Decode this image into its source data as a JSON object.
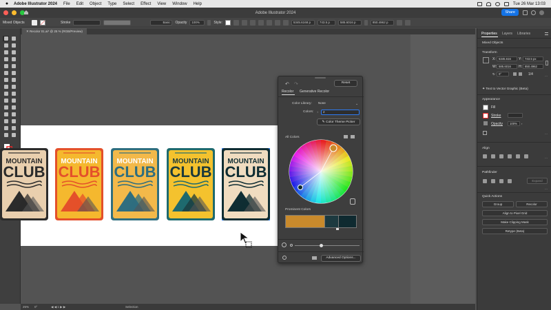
{
  "menubar": {
    "app_name": "Adobe Illustrator 2024",
    "items": [
      "File",
      "Edit",
      "Object",
      "Type",
      "Select",
      "Effect",
      "View",
      "Window",
      "Help"
    ],
    "clock": "Tue 26 Mar  13:03"
  },
  "window": {
    "title": "Adobe Illustrator 2024",
    "share_label": "Share"
  },
  "controlbar": {
    "selection_type": "Mixed Objects",
    "stroke_label": "Stroke",
    "brush_label": "Basic",
    "opacity_label": "Opacity",
    "opacity_value": "100%",
    "style_label": "Style:",
    "x_value": "5345.6168 p",
    "y_value": "743.5 p",
    "w_value": "585.6016 p",
    "h_value": "850.4962 p"
  },
  "document": {
    "tab_label": "Recolor 01.ai* @ 25 % (RGB/Preview)"
  },
  "statusbar": {
    "zoom": "25%",
    "tool": "Selection"
  },
  "badges": [
    {
      "top": "MOUNTAIN",
      "bottom": "CLUB",
      "bg": "#e9cfae",
      "frame": "#2b2b2b",
      "text1": "#2b2b2b",
      "text2": "#2b2b2b"
    },
    {
      "top": "MOUNTAIN",
      "bottom": "CLUB",
      "bg": "#f5b82e",
      "frame": "#e4502a",
      "text1": "#ffffff",
      "text2": "#e4502a"
    },
    {
      "top": "MOUNTAIN",
      "bottom": "CLUB",
      "bg": "#f3b94a",
      "frame": "#2f6e7f",
      "text1": "#ffffff",
      "text2": "#2f6e7f"
    },
    {
      "top": "MOUNTAIN",
      "bottom": "CLUB",
      "bg": "#f4c22e",
      "frame": "#1e6a6e",
      "text1": "#1b3a3c",
      "text2": "#1b3a3c"
    },
    {
      "top": "MOUNTAIN",
      "bottom": "CLUB",
      "bg": "#f0dcc0",
      "frame": "#0f2d33",
      "text1": "#0f2d33",
      "text2": "#0f2d33"
    }
  ],
  "recolor": {
    "reset_label": "Reset",
    "tabs": [
      "Recolor",
      "Generative Recolor"
    ],
    "color_library_label": "Color Library:",
    "color_library_value": "None",
    "colors_label": "Colors:",
    "colors_value": "2",
    "theme_picker_label": "Color Theme Picker",
    "all_colors_label": "All Colors",
    "prominent_colors_label": "Prominent Colors",
    "prominent_colors": [
      "#c98a2c",
      "#1d3a40",
      "#0f2a30"
    ],
    "advanced_label": "Advanced Options..."
  },
  "properties": {
    "tabs": [
      "Properties",
      "Layers",
      "Libraries"
    ],
    "selection_type": "Mixed Objects",
    "transform_title": "Transform",
    "x_label": "X:",
    "x_value": "5345.616",
    "y_label": "Y:",
    "y_value": "743.5 px",
    "w_label": "W:",
    "w_value": "585.6016",
    "h_label": "H:",
    "h_value": "850.4962",
    "angle_value": "0°",
    "ratio_value": "1/4",
    "text_to_vector": "Text to Vector Graphic (Beta)",
    "appearance_title": "Appearance",
    "fill_label": "Fill",
    "stroke_label": "Stroke",
    "opacity_label": "Opacity",
    "opacity_value": "100%",
    "align_title": "Align",
    "pathfinder_title": "Pathfinder",
    "expand_label": "Expand",
    "quick_actions_title": "Quick Actions",
    "group_label": "Group",
    "recolor_label": "Recolor",
    "align_pixel_label": "Align to Pixel Grid",
    "clipping_label": "Make Clipping Mask",
    "retype_label": "Retype (Beta)"
  }
}
